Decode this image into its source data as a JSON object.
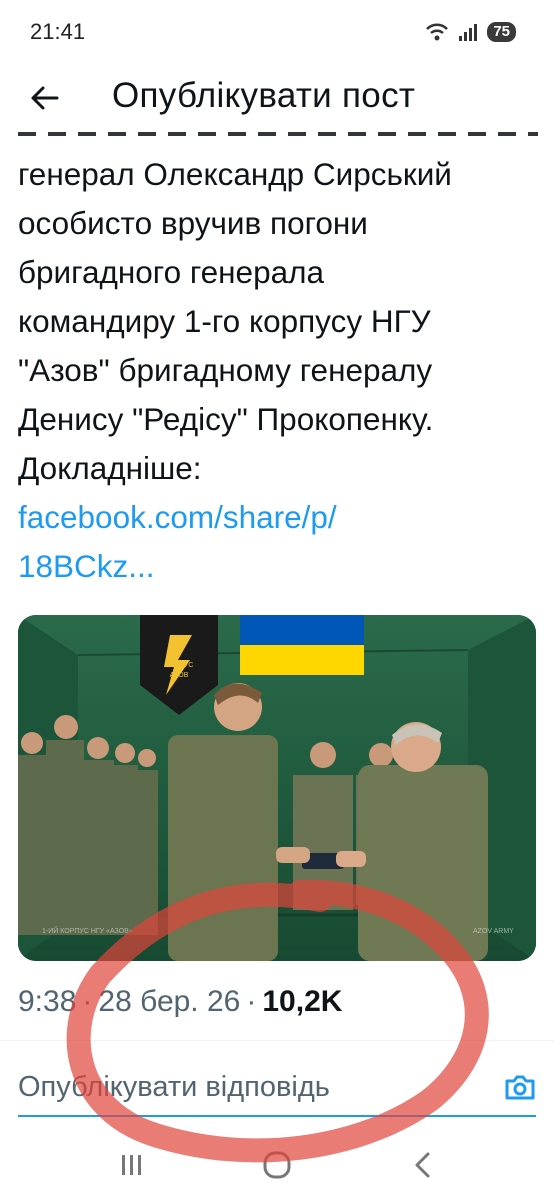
{
  "status_bar": {
    "time": "21:41",
    "battery": "75",
    "icons": [
      "wifi-icon",
      "signal-icon"
    ]
  },
  "header": {
    "back_icon": "arrow-left-icon",
    "title": "Опублікувати пост"
  },
  "post": {
    "lines": [
      "генерал Олександр Сирський",
      "особисто вручив погони",
      "бригадного генерала",
      "командиру 1-го корпусу НГУ",
      "\"Азов\" бригадному генералу",
      "Денису \"Редісу\" Прокопенку.",
      "Докладніше:"
    ],
    "link_lines": [
      "facebook.com/share/p/",
      "18BCkz..."
    ],
    "image": {
      "flag_colors": [
        "#0057b7",
        "#ffd700"
      ],
      "banner_text_1": "КОРПУС",
      "banner_text_2": "АЗОВ",
      "watermark_left": "1-ИЙ КОРПУС НГУ «АЗОВ»",
      "watermark_right": "AZOV ARMY"
    }
  },
  "meta": {
    "time": "9:38",
    "sep1": "·",
    "date": "28 бер. 26",
    "sep2": "·",
    "views": "10,2K"
  },
  "reply": {
    "placeholder": "Опублікувати відповідь",
    "camera_icon": "camera-icon"
  },
  "nav": {
    "icons": [
      "recent-apps-icon",
      "home-icon",
      "back-icon"
    ]
  },
  "colors": {
    "link": "#1d9bf0",
    "text": "#0f1419",
    "muted": "#536471",
    "annotation": "#e0443a"
  }
}
